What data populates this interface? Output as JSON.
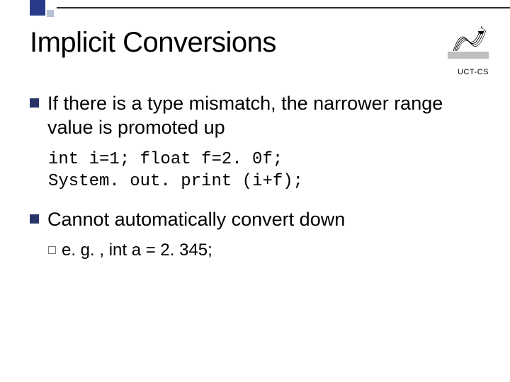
{
  "title": "Implicit Conversions",
  "org": "UCT-CS",
  "bullets": {
    "b1": "If there is a type mismatch, the narrower range value is promoted up",
    "b2": "Cannot automatically convert down"
  },
  "code": {
    "line1": "int i=1; float f=2. 0f;",
    "line2": "System. out. print (i+f);"
  },
  "sub": {
    "prefix": "e. g. ,",
    "rest": " int a = 2. 345;"
  }
}
